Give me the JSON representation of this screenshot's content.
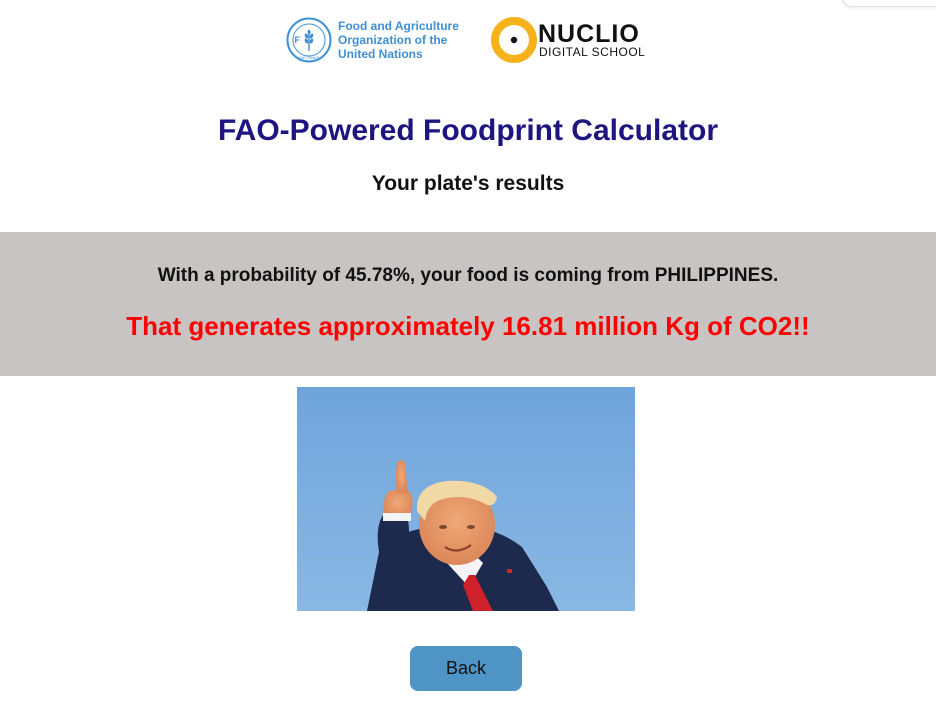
{
  "logos": {
    "fao": {
      "emblem_letters": "FAO",
      "emblem_motto": "FIAT PANIS",
      "name_lines": [
        "Food and Agriculture",
        "Organization of the",
        "United Nations"
      ],
      "color": "#3f8fd4"
    },
    "nuclio": {
      "name": "NUCLIO",
      "subtitle": "DIGITAL SCHOOL",
      "accent_color": "#f5b21a"
    }
  },
  "header": {
    "title": "FAO-Powered Foodprint Calculator",
    "subtitle": "Your plate's results"
  },
  "results": {
    "probability_text": "With a probability of 45.78%, your food is coming from PHILIPPINES.",
    "co2_text": "That generates approximately 16.81 million Kg of CO2!!",
    "co2_color": "#ff0000",
    "band_color": "#c9c4c4"
  },
  "photo": {
    "subject": "thumbs-up-photo"
  },
  "actions": {
    "back_label": "Back",
    "back_color": "#4e94c4"
  },
  "colors": {
    "title": "#1f1581"
  }
}
